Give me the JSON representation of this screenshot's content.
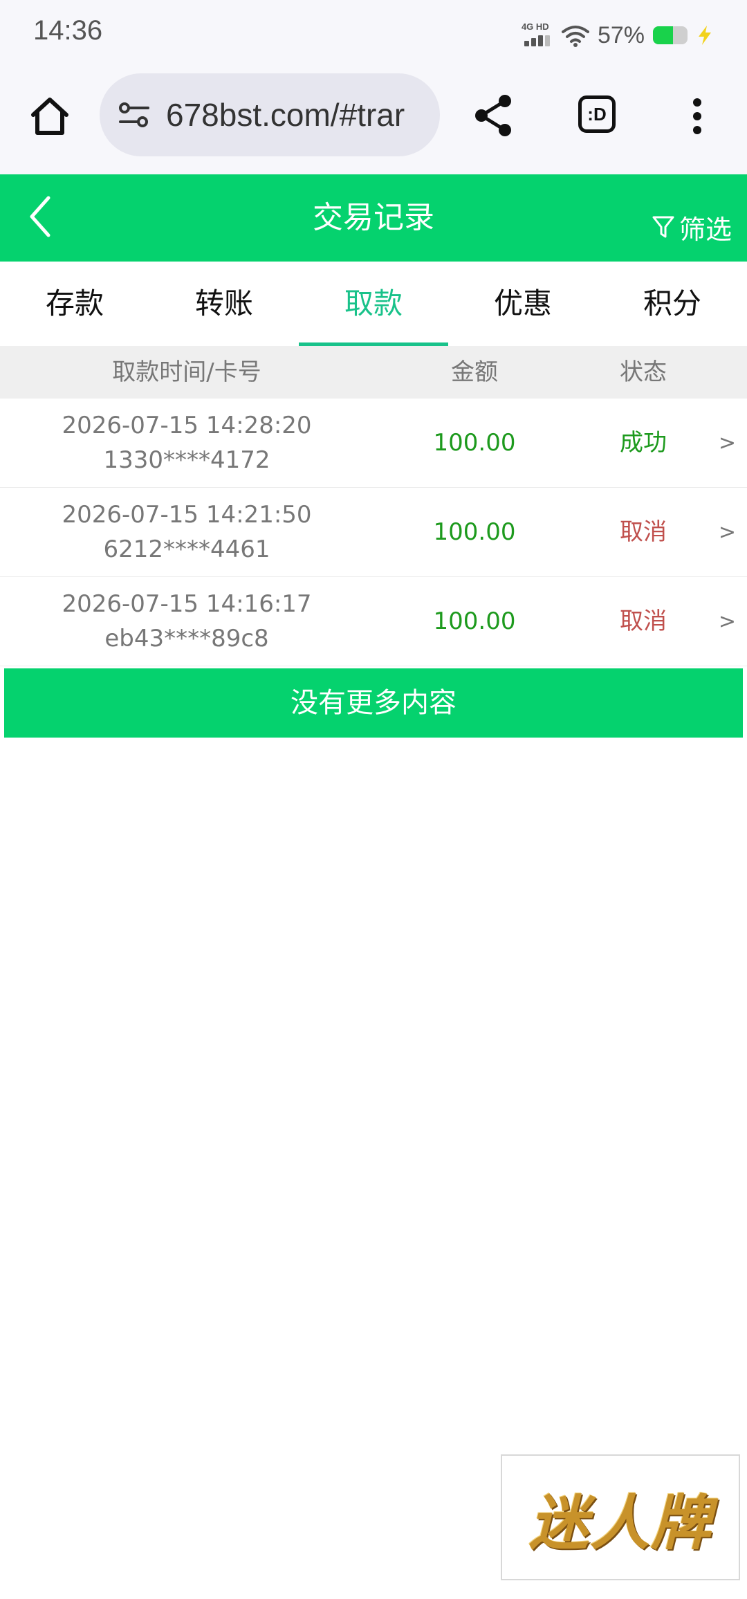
{
  "status_bar": {
    "time": "14:36",
    "network_label": "4G HD",
    "battery_percent": "57%",
    "battery_level": 0.57,
    "battery_color": "#19d24b"
  },
  "browser": {
    "url": "678bst.com/#trar",
    "tabs_label": ":D",
    "icons": [
      "home-icon",
      "site-settings-icon",
      "share-icon",
      "tab-switcher-icon",
      "more-menu-icon"
    ]
  },
  "header": {
    "title": "交易记录",
    "filter_label": "筛选",
    "bg_color": "#05d26e"
  },
  "tabs": [
    {
      "label": "存款",
      "active": false
    },
    {
      "label": "转账",
      "active": false
    },
    {
      "label": "取款",
      "active": true
    },
    {
      "label": "优惠",
      "active": false
    },
    {
      "label": "积分",
      "active": false
    }
  ],
  "table": {
    "headers": {
      "time_card": "取款时间/卡号",
      "amount": "金额",
      "status": "状态"
    },
    "rows": [
      {
        "datetime": "2026-07-15 14:28:20",
        "card": "1330****4172",
        "amount": "100.00",
        "status": "成功",
        "status_color": "#1d9a1d",
        "arrow": ">"
      },
      {
        "datetime": "2026-07-15 14:21:50",
        "card": "6212****4461",
        "amount": "100.00",
        "status": "取消",
        "status_color": "#c0504d",
        "arrow": ">"
      },
      {
        "datetime": "2026-07-15 14:16:17",
        "card": "eb43****89c8",
        "amount": "100.00",
        "status": "取消",
        "status_color": "#c0504d",
        "arrow": ">"
      }
    ]
  },
  "no_more_label": "没有更多内容",
  "logo": {
    "text": "迷人牌"
  }
}
